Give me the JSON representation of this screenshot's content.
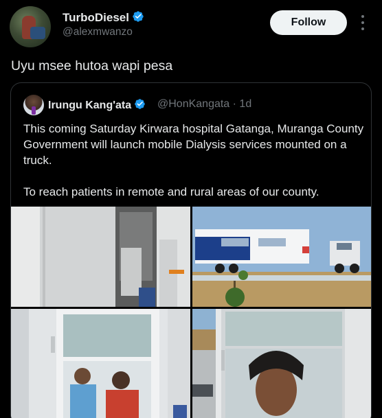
{
  "author": {
    "name": "TurboDiesel",
    "handle": "@alexmwanzo",
    "verified": true,
    "avatar_icon": "profile-photo"
  },
  "follow_label": "Follow",
  "more_icon": "more-vertical-icon",
  "post_text": "Uyu msee hutoa wapi pesa",
  "quote": {
    "name": "Irungu Kang'ata",
    "handle_time": "@HonKangata · 1d",
    "paragraphs": [
      "This coming Saturday Kirwara hospital Gatanga, Muranga County Government will launch mobile Dialysis services mounted on a truck.",
      "To reach patients in remote and rural areas of our county."
    ],
    "media": [
      {
        "name": "interior-doorway-photo"
      },
      {
        "name": "dialysis-truck-photo"
      },
      {
        "name": "glass-door-poster-photo"
      },
      {
        "name": "interior-door-portrait-photo"
      }
    ]
  },
  "colors": {
    "background": "#000000",
    "text": "#e7e9ea",
    "secondary": "#71767b",
    "verified": "#1d9bf0",
    "border": "#2f3336"
  }
}
